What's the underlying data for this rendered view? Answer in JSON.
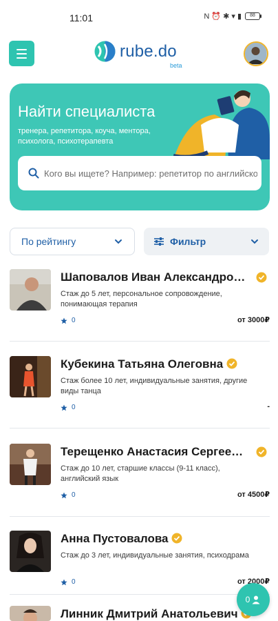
{
  "status_bar": {
    "time": "11:01",
    "icons_text": "N ⏰ ✱ ▾ ▮",
    "battery": "88"
  },
  "header": {
    "menu_icon": "hamburger-icon",
    "logo_text": "rube.do",
    "logo_badge": "beta",
    "avatar_icon": "user-avatar"
  },
  "hero": {
    "title": "Найти специалиста",
    "subtitle": "тренера, репетитора, коуча, ментора, психолога, психотерапевта",
    "search_placeholder": "Кого вы ищете? Например: репетитор по английскому",
    "colors": {
      "background": "#3ec7b6",
      "accent": "#f0b429",
      "brand_blue": "#1f5fa6"
    }
  },
  "filters": {
    "sort_label": "По рейтингу",
    "filter_label": "Фильтр"
  },
  "specialists": [
    {
      "name": "Шаповалов Иван Александро…",
      "description": "Стаж до 5 лет, персональное сопровождение, понимающая терапия",
      "rating": "0",
      "price": "от 3000₽"
    },
    {
      "name": "Кубекина Татьяна Олеговна",
      "description": "Стаж более 10 лет, индивидуальные занятия, другие виды танца",
      "rating": "0",
      "price": "-"
    },
    {
      "name": "Терещенко Анастасия Сергее…",
      "description": "Стаж до 10 лет, старшие классы (9-11 класс), английский язык",
      "rating": "0",
      "price": "от 4500₽"
    },
    {
      "name": "Анна Пустовалова",
      "description": "Стаж до 3 лет, индивидуальные занятия, психодрама",
      "rating": "0",
      "price": "от 2000₽"
    },
    {
      "name": "Линник Дмитрий Анатольевич",
      "description": "",
      "rating": "",
      "price": ""
    }
  ],
  "fab": {
    "count": "0",
    "icon": "person-icon"
  }
}
